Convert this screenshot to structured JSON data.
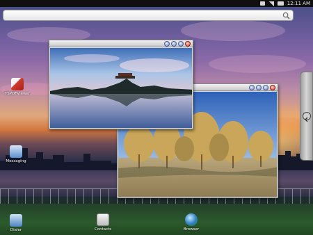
{
  "status_bar": {
    "time": "12:11 AM"
  },
  "search": {
    "value": "",
    "placeholder": ""
  },
  "desktop_icons": [
    {
      "label": "TSPDFViewer",
      "icon": "pdf-viewer-icon",
      "color": "#d23b2e"
    },
    {
      "label": "Messaging",
      "icon": "messaging-icon",
      "color": "#5a8fd0"
    },
    {
      "label": "Dialer",
      "icon": "dialer-icon",
      "color": "#7fb4e6"
    },
    {
      "label": "Contacts",
      "icon": "contacts-icon",
      "color": "#e0e0e0"
    },
    {
      "label": "Browser",
      "icon": "browser-icon",
      "color": "#3d9f4a"
    }
  ],
  "windows": [
    {
      "id": "window-front",
      "title": "",
      "content": "lake-pavilion-photo"
    },
    {
      "id": "window-back",
      "title": "",
      "content": "trees-park-photo"
    }
  ],
  "colors": {
    "close_button": "#d23a28",
    "window_button": "#6f86c4",
    "status_bar_bg": "#101010"
  }
}
